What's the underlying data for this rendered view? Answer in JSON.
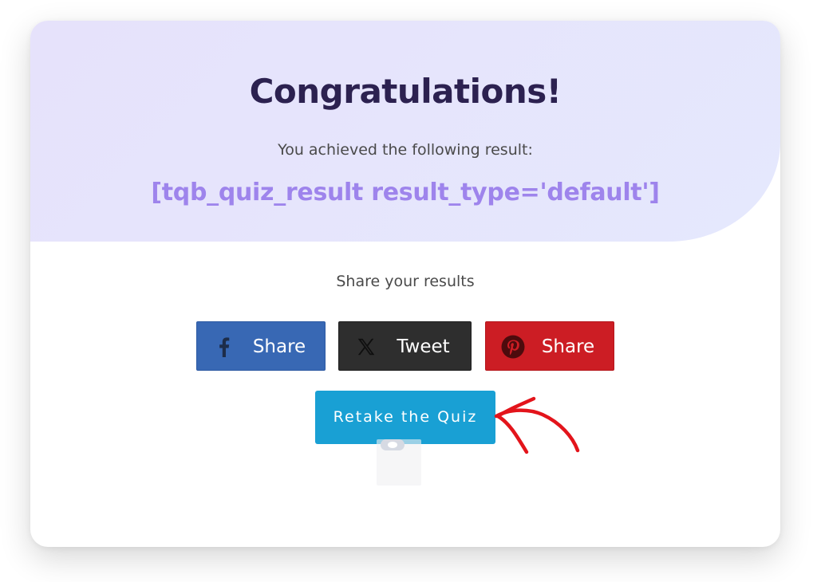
{
  "hero": {
    "title": "Congratulations!",
    "subtitle": "You achieved the following result:",
    "result_shortcode": "[tqb_quiz_result result_type='default']"
  },
  "share": {
    "label": "Share your results",
    "buttons": [
      {
        "network": "facebook",
        "icon": "facebook-icon",
        "label": "Share",
        "color": "#3868b4"
      },
      {
        "network": "x",
        "icon": "x-twitter-icon",
        "label": "Tweet",
        "color": "#2e2e2e"
      },
      {
        "network": "pinterest",
        "icon": "pinterest-icon",
        "label": "Share",
        "color": "#cc1d24"
      }
    ]
  },
  "retake": {
    "label": "Retake the Quiz",
    "color": "#19a0d4"
  },
  "colors": {
    "title": "#2c2150",
    "result_shortcode": "#9e84ec",
    "hero_bg": "#e6e2fb",
    "annotation_arrow": "#e3141b"
  }
}
